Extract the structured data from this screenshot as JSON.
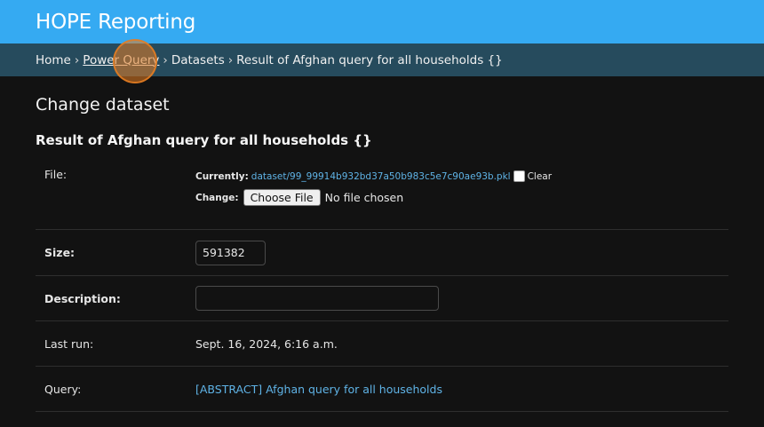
{
  "header": {
    "title": "HOPE Reporting"
  },
  "breadcrumbs": {
    "home": "Home",
    "sep": "›",
    "power_query": "Power Query",
    "datasets": "Datasets",
    "current": "Result of Afghan query for all households {}"
  },
  "page": {
    "title": "Change dataset",
    "object_title": "Result of Afghan query for all households {}"
  },
  "form": {
    "file": {
      "label": "File:",
      "currently_label": "Currently:",
      "current_file": "dataset/99_99914b932bd37a50b983c5e7c90ae93b.pkl",
      "clear_label": "Clear",
      "change_label": "Change:",
      "button_label": "Choose File",
      "no_file_text": "No file chosen"
    },
    "size": {
      "label": "Size:",
      "value": "591382"
    },
    "description": {
      "label": "Description:",
      "value": ""
    },
    "last_run": {
      "label": "Last run:",
      "value": "Sept. 16, 2024, 6:16 a.m."
    },
    "query": {
      "label": "Query:",
      "value": "[ABSTRACT] Afghan query for all households"
    }
  },
  "colors": {
    "header_bg": "#35aaf2",
    "breadcrumb_bg": "#264b5d",
    "page_bg": "#121212",
    "link": "#5fb3e6",
    "click_indicator": "#e67e22"
  }
}
